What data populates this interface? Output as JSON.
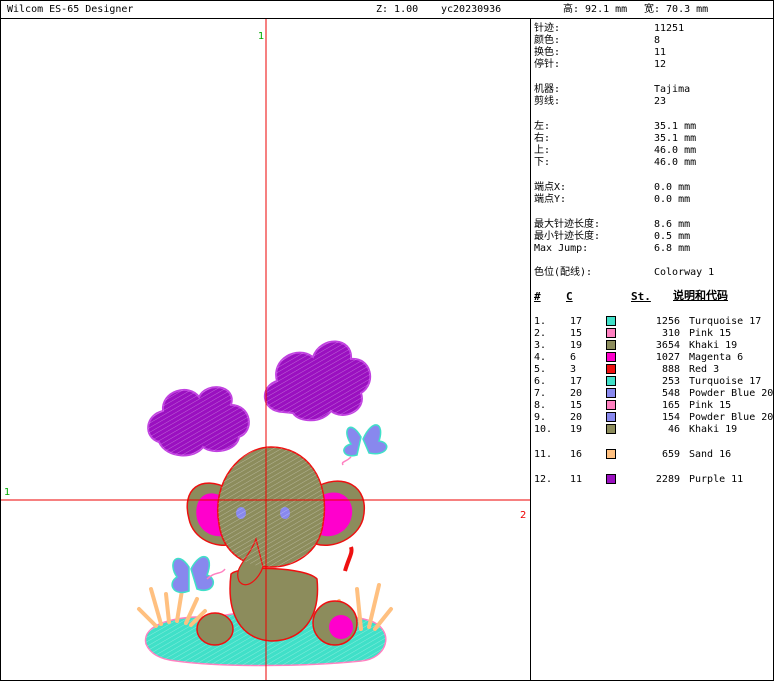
{
  "titlebar": {
    "app": "Wilcom ES-65 Designer",
    "zoom": "Z: 1.00",
    "file": "yc20230936",
    "height": "高: 92.1 mm",
    "width": "宽: 70.3 mm"
  },
  "axis_labels": {
    "top": "1",
    "left": "1",
    "right": "2"
  },
  "stats": [
    {
      "label": "针迹:",
      "value": "11251"
    },
    {
      "label": "颜色:",
      "value": "8"
    },
    {
      "label": "换色:",
      "value": "11"
    },
    {
      "label": "停针:",
      "value": "12"
    },
    {
      "label": "机器:",
      "value": "Tajima"
    },
    {
      "label": "剪线:",
      "value": "23"
    },
    {
      "label": "左:",
      "value": "35.1 mm"
    },
    {
      "label": "右:",
      "value": "35.1 mm"
    },
    {
      "label": "上:",
      "value": "46.0 mm"
    },
    {
      "label": "下:",
      "value": "46.0 mm"
    },
    {
      "label": "端点X:",
      "value": "0.0 mm"
    },
    {
      "label": "端点Y:",
      "value": "0.0 mm"
    },
    {
      "label": "最大针迹长度:",
      "value": "8.6 mm"
    },
    {
      "label": "最小针迹长度:",
      "value": "0.5 mm"
    },
    {
      "label": "Max Jump:",
      "value": "6.8 mm"
    },
    {
      "label": "色位(配线):",
      "value": "Colorway 1"
    }
  ],
  "colors_header": {
    "num": "#",
    "code": "C",
    "stitches": "St.",
    "desc": "说明和代码"
  },
  "color_list": [
    {
      "num": "1.",
      "code": "17",
      "color": "#40e0c8",
      "st": "1256",
      "name": "Turquoise 17"
    },
    {
      "num": "2.",
      "code": "15",
      "color": "#ff80c0",
      "st": "310",
      "name": "Pink 15"
    },
    {
      "num": "3.",
      "code": "19",
      "color": "#8c8c5c",
      "st": "3654",
      "name": "Khaki 19"
    },
    {
      "num": "4.",
      "code": "6",
      "color": "#ff00cc",
      "st": "1027",
      "name": "Magenta 6"
    },
    {
      "num": "5.",
      "code": "3",
      "color": "#ee1010",
      "st": "888",
      "name": "Red 3"
    },
    {
      "num": "6.",
      "code": "17",
      "color": "#40e0c8",
      "st": "253",
      "name": "Turquoise 17"
    },
    {
      "num": "7.",
      "code": "20",
      "color": "#8888ee",
      "st": "548",
      "name": "Powder Blue 20"
    },
    {
      "num": "8.",
      "code": "15",
      "color": "#ff80c0",
      "st": "165",
      "name": "Pink 15"
    },
    {
      "num": "9.",
      "code": "20",
      "color": "#8888ee",
      "st": "154",
      "name": "Powder Blue 20"
    },
    {
      "num": "10.",
      "code": "19",
      "color": "#8c8c5c",
      "st": "46",
      "name": "Khaki 19"
    },
    {
      "num": "11.",
      "code": "16",
      "color": "#ffc080",
      "st": "659",
      "name": "Sand 16"
    },
    {
      "num": "12.",
      "code": "11",
      "color": "#9a10c0",
      "st": "2289",
      "name": "Purple 11"
    }
  ]
}
